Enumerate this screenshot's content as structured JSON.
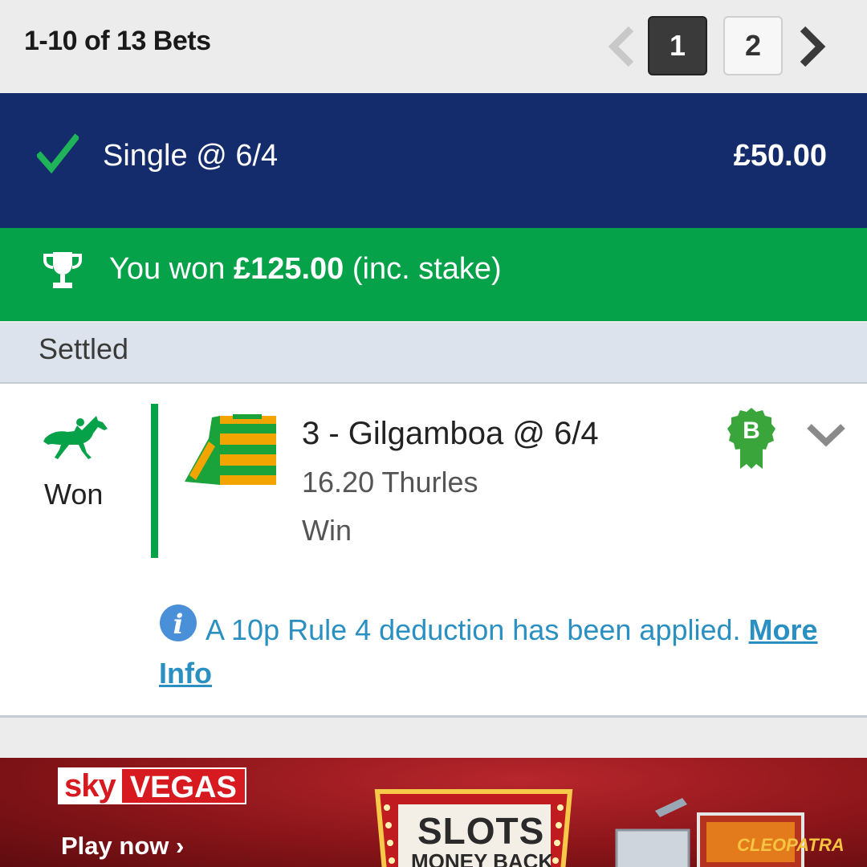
{
  "pagination": {
    "count_label": "1-10 of 13 Bets",
    "pages": [
      "1",
      "2"
    ],
    "active_page": "1"
  },
  "bet": {
    "type_label": "Single @ 6/4",
    "stake": "£50.00"
  },
  "result_banner": {
    "prefix": "You won ",
    "amount": "£125.00",
    "suffix": " (inc. stake)"
  },
  "status": {
    "label": "Settled"
  },
  "selection": {
    "result": "Won",
    "name": "3 - Gilgamboa @ 6/4",
    "race": "16.20 Thurles",
    "market": "Win",
    "badge_letter": "B"
  },
  "notice": {
    "text": "A 10p Rule 4 deduction has been applied. ",
    "link_label": "More Info"
  },
  "ad": {
    "brand_sky": "sky",
    "brand_vegas": "VEGAS",
    "cta": "Play now",
    "headline": "SLOTS",
    "subheadline": "MONEY BACK",
    "game_name": "CLEOPATRA"
  },
  "colors": {
    "header_navy": "#142c6b",
    "won_green": "#06a24a",
    "link_blue": "#2a8fc1",
    "settled_bg": "#dde3ec"
  },
  "icons": [
    "chevron-left-icon",
    "chevron-right-icon",
    "check-icon",
    "trophy-icon",
    "horse-icon",
    "jockey-silks-icon",
    "boost-badge-icon",
    "chevron-down-icon",
    "info-icon"
  ]
}
